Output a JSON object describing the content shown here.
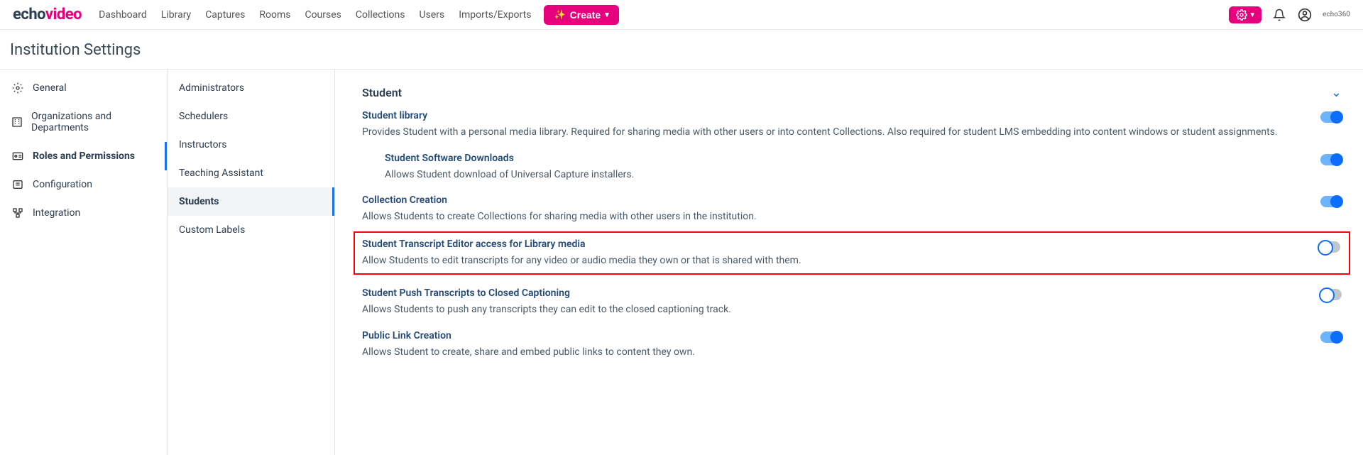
{
  "logo": {
    "part1": "echo",
    "part2": "video"
  },
  "nav": {
    "dashboard": "Dashboard",
    "library": "Library",
    "captures": "Captures",
    "rooms": "Rooms",
    "courses": "Courses",
    "collections": "Collections",
    "users": "Users",
    "imports_exports": "Imports/Exports"
  },
  "create_label": "Create",
  "brandlet": "echo360",
  "page_title": "Institution Settings",
  "left_nav": {
    "general": "General",
    "orgs": "Organizations and Departments",
    "roles": "Roles and Permissions",
    "config": "Configuration",
    "integration": "Integration"
  },
  "mid_nav": {
    "administrators": "Administrators",
    "schedulers": "Schedulers",
    "instructors": "Instructors",
    "teaching_assistant": "Teaching Assistant",
    "students": "Students",
    "custom_labels": "Custom Labels"
  },
  "section": {
    "title": "Student"
  },
  "settings": {
    "student_library": {
      "title": "Student library",
      "desc": "Provides Student with a personal media library. Required for sharing media with other users or into content Collections. Also required for student LMS embedding into content windows or student assignments."
    },
    "software_downloads": {
      "title": "Student Software Downloads",
      "desc": "Allows Student download of Universal Capture installers."
    },
    "collection_creation": {
      "title": "Collection Creation",
      "desc": "Allows Students to create Collections for sharing media with other users in the institution."
    },
    "transcript_editor": {
      "title": "Student Transcript Editor access for Library media",
      "desc": "Allow Students to edit transcripts for any video or audio media they own or that is shared with them."
    },
    "push_transcripts": {
      "title": "Student Push Transcripts to Closed Captioning",
      "desc": "Allows Students to push any transcripts they can edit to the closed captioning track."
    },
    "public_link": {
      "title": "Public Link Creation",
      "desc": "Allows Student to create, share and embed public links to content they own."
    }
  }
}
